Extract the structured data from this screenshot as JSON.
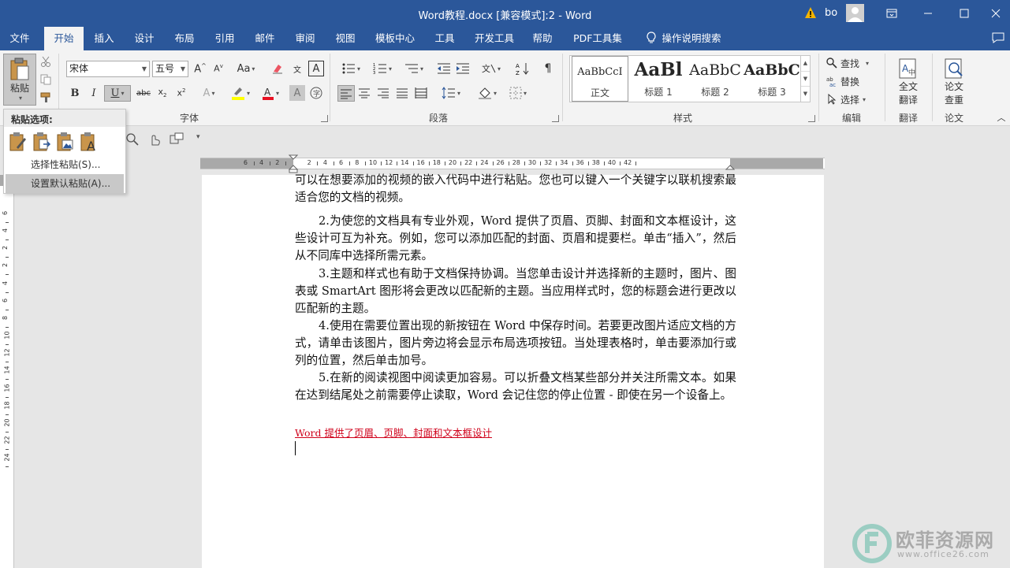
{
  "window": {
    "title": "Word教程.docx [兼容模式]:2  -  Word",
    "user": "bo"
  },
  "tabs": [
    "文件",
    "开始",
    "插入",
    "设计",
    "布局",
    "引用",
    "邮件",
    "审阅",
    "视图",
    "模板中心",
    "工具",
    "开发工具",
    "帮助",
    "PDF工具集"
  ],
  "active_tab": "开始",
  "tell_me": "操作说明搜索",
  "clipboard": {
    "paste_label": "粘贴"
  },
  "font": {
    "name": "宋体",
    "size": "五号",
    "group_label": "字体"
  },
  "paragraph": {
    "group_label": "段落"
  },
  "styles": {
    "group_label": "样式",
    "items": [
      {
        "sample": "AaBbCcI",
        "name": "正文"
      },
      {
        "sample": "AaBl",
        "name": "标题 1"
      },
      {
        "sample": "AaBbC",
        "name": "标题 2"
      },
      {
        "sample": "AaBbC",
        "name": "标题 3"
      }
    ]
  },
  "editing": {
    "find": "查找",
    "replace": "替换",
    "select": "选择",
    "group_label": "编辑"
  },
  "translate": {
    "button": "全文\n翻译",
    "line1": "全文",
    "line2": "翻译",
    "group_label": "翻译"
  },
  "thesis": {
    "line1": "论文",
    "line2": "查重",
    "group_label": "论文"
  },
  "paste_menu": {
    "header": "粘贴选项:",
    "items": [
      "选择性粘贴(S)...",
      "设置默认粘贴(A)..."
    ]
  },
  "ruler": {
    "h_ticks": [
      "6",
      "4",
      "2",
      "2",
      "4",
      "6",
      "8",
      "10",
      "12",
      "14",
      "16",
      "18",
      "20",
      "22",
      "24",
      "26",
      "28",
      "30",
      "32",
      "34",
      "36",
      "38",
      "40",
      "42"
    ],
    "v_ticks": [
      "6",
      "4",
      "2",
      "2",
      "4",
      "6",
      "8",
      "10",
      "12",
      "14",
      "16",
      "18",
      "20",
      "22",
      "24"
    ]
  },
  "document": {
    "paragraphs": [
      "可以在想要添加的视频的嵌入代码中进行粘贴。您也可以键入一个关键字以联机搜索最适合您的文档的视频。",
      "2.为使您的文档具有专业外观，Word 提供了页眉、页脚、封面和文本框设计，这些设计可互为补充。例如，您可以添加匹配的封面、页眉和提要栏。单击“插入”，然后从不同库中选择所需元素。",
      "3.主题和样式也有助于文档保持协调。当您单击设计并选择新的主题时，图片、图表或 SmartArt 图形将会更改以匹配新的主题。当应用样式时，您的标题会进行更改以匹配新的主题。",
      "4.使用在需要位置出现的新按钮在 Word 中保存时间。若要更改图片适应文档的方式，请单击该图片，图片旁边将会显示布局选项按钮。当处理表格时，单击要添加行或列的位置，然后单击加号。",
      "5.在新的阅读视图中阅读更加容易。可以折叠文档某些部分并关注所需文本。如果在达到结尾处之前需要停止读取，Word 会记住您的停止位置 - 即使在另一个设备上。"
    ],
    "red_text": "Word 提供了页眉、页脚、封面和文本框设计"
  },
  "watermark": {
    "name": "欧菲资源网",
    "url": "www.office26.com"
  },
  "colors": {
    "accent": "#2b579a",
    "highlight": "#ffff00",
    "font_color": "#e81123",
    "red_text": "#d0021b"
  }
}
